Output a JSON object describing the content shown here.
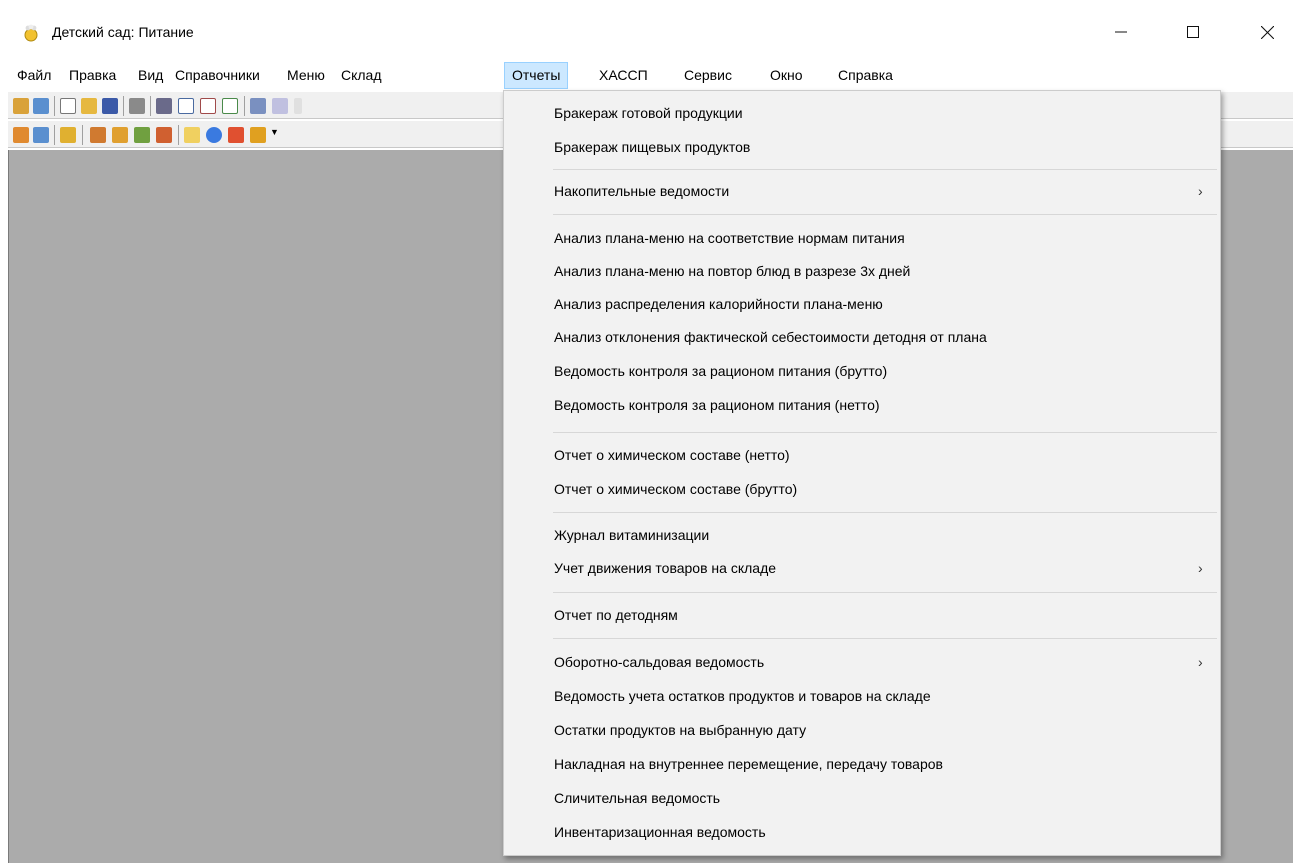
{
  "window": {
    "title": "Детский сад: Питание"
  },
  "menubar": [
    "Файл",
    "Правка",
    "Вид",
    "Справочники",
    "Меню",
    "Склад",
    "Отчеты",
    "ХАССП",
    "Сервис",
    "Окно",
    "Справка"
  ],
  "reports_menu": {
    "items": [
      {
        "label": "Бракераж готовой продукции"
      },
      {
        "label": "Бракераж пищевых продуктов"
      },
      {
        "label": "Накопительные ведомости",
        "submenu": true
      },
      {
        "label": "Анализ плана-меню на соответствие нормам питания"
      },
      {
        "label": "Анализ плана-меню на повтор блюд в разрезе 3х дней"
      },
      {
        "label": "Анализ распределения калорийности плана-меню"
      },
      {
        "label": "Анализ отклонения фактической себестоимости детодня от плана"
      },
      {
        "label": "Ведомость контроля за рационом питания (брутто)"
      },
      {
        "label": "Ведомость контроля за рационом питания (нетто)"
      },
      {
        "label": "Отчет о химическом составе (нетто)"
      },
      {
        "label": "Отчет о химическом составе (брутто)"
      },
      {
        "label": "Журнал витаминизации"
      },
      {
        "label": "Учет движения товаров на складе",
        "submenu": true
      },
      {
        "label": "Отчет по детодням"
      },
      {
        "label": "Оборотно-сальдовая ведомость",
        "submenu": true
      },
      {
        "label": "Ведомость учета остатков продуктов и товаров на складе"
      },
      {
        "label": "Остатки продуктов на выбранную дату"
      },
      {
        "label": "Накладная на внутреннее перемещение, передачу товаров"
      },
      {
        "label": "Сличительная ведомость"
      },
      {
        "label": "Инвентаризационная ведомость"
      }
    ]
  },
  "colors": {
    "menu_highlight": "#cce8ff",
    "client_area": "#ababab",
    "dropdown_bg": "#f2f2f2"
  }
}
